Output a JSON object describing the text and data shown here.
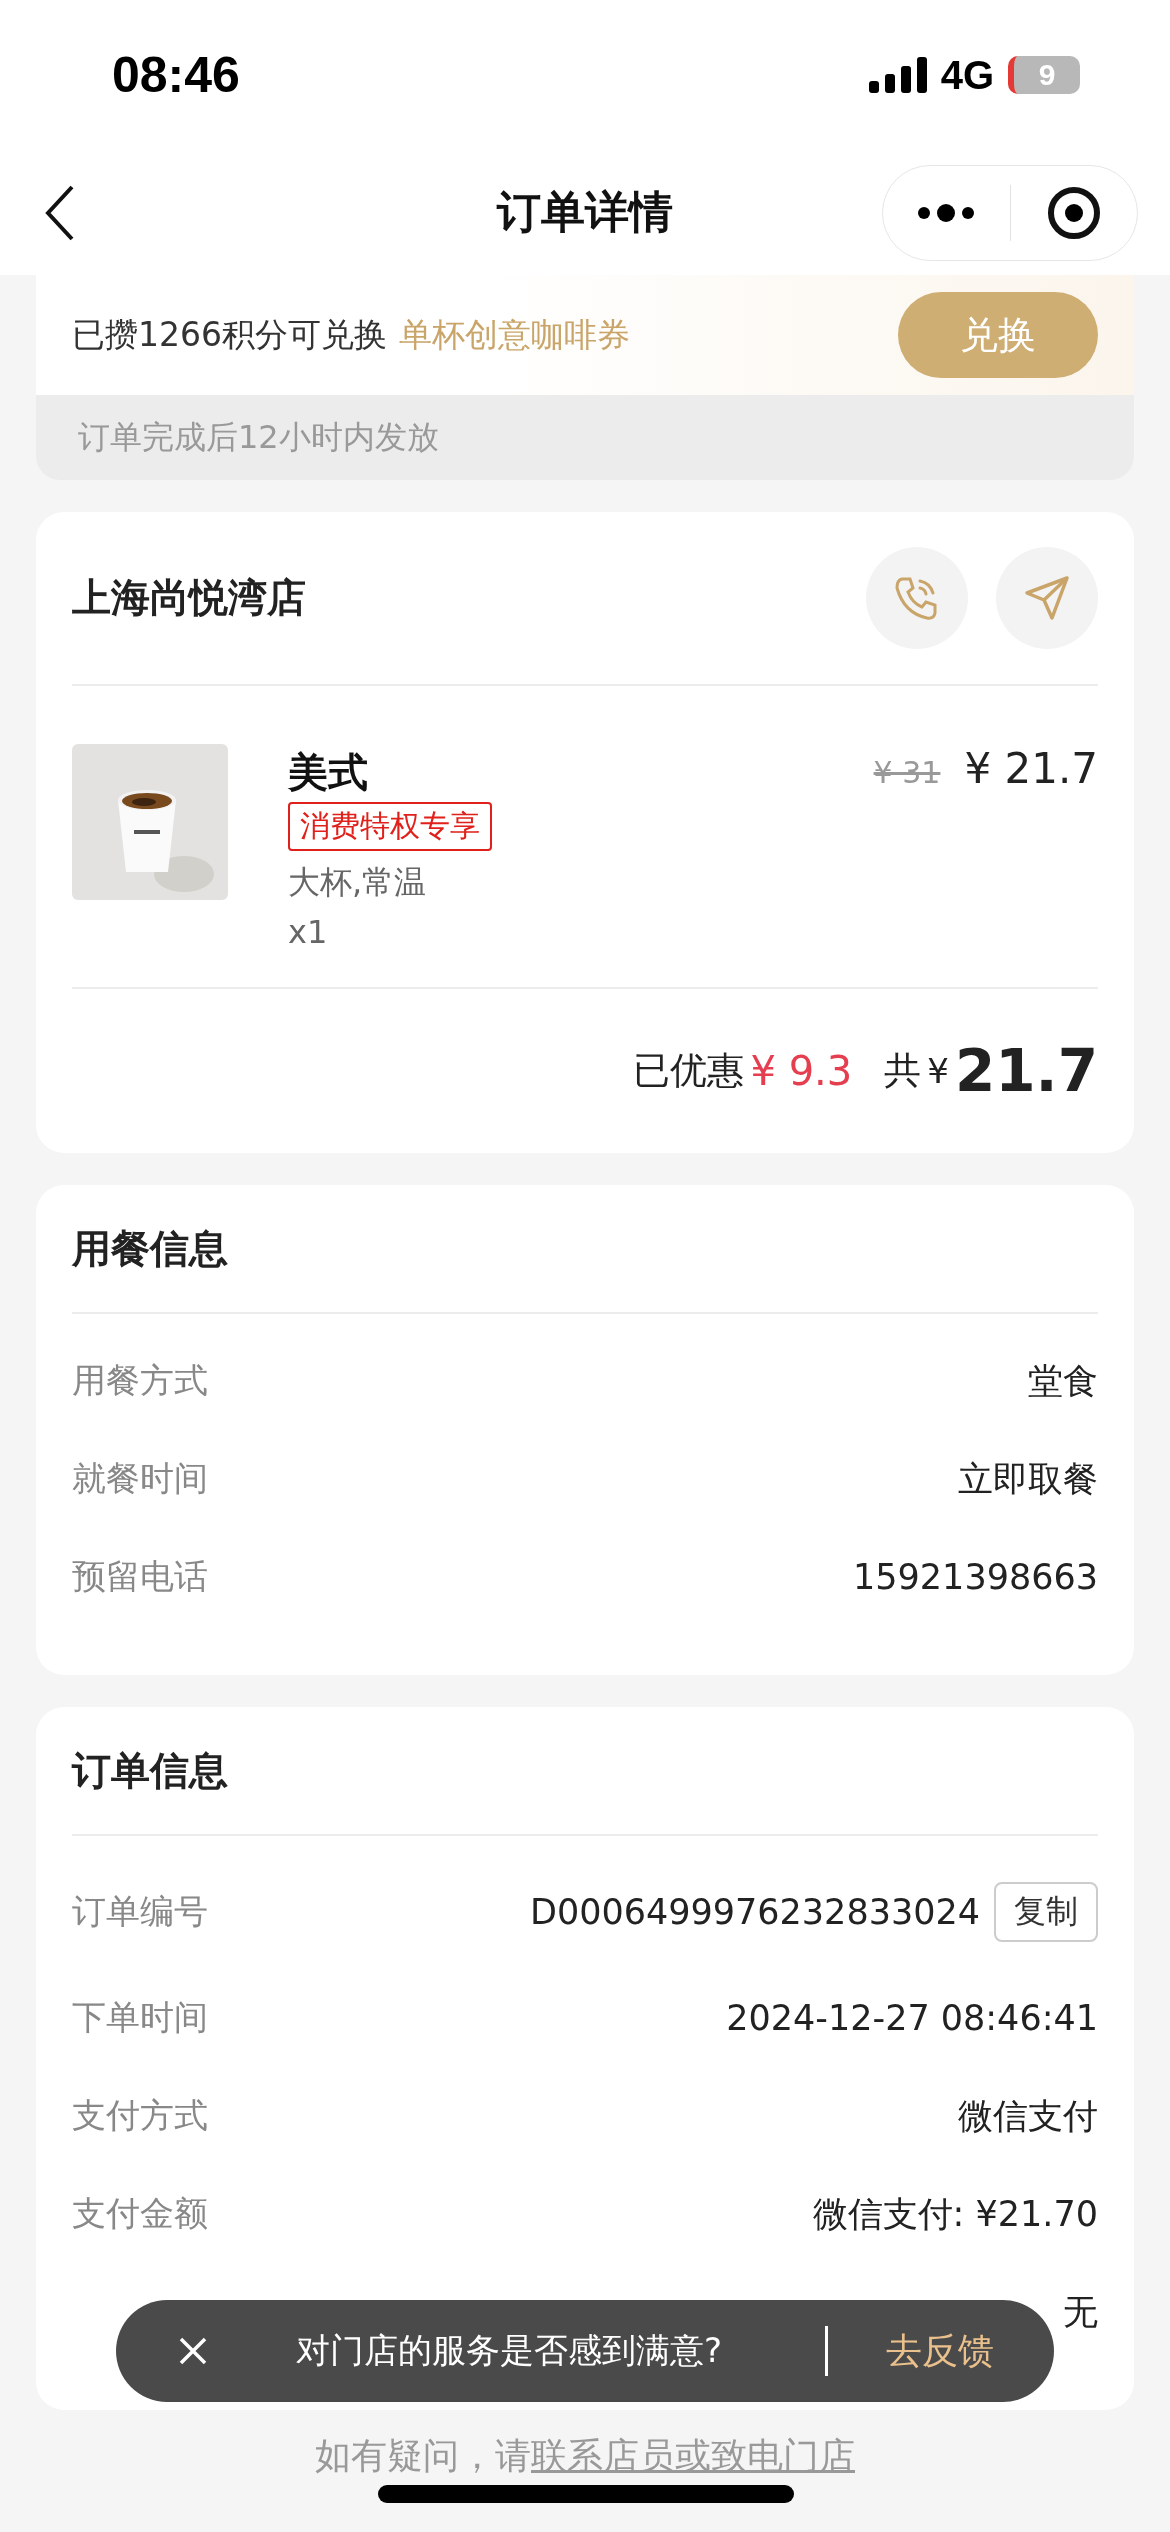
{
  "status_bar": {
    "time": "08:46",
    "network": "4G",
    "battery": "9"
  },
  "nav": {
    "title": "订单详情"
  },
  "points_banner": {
    "text": "已攒1266积分可兑换",
    "coupon": "单杯创意咖啡券",
    "button": "兑换",
    "note": "订单完成后12小时内发放"
  },
  "store": {
    "name": "上海尚悦湾店",
    "items": [
      {
        "name": "美式",
        "tag": "消费特权专享",
        "specs": "大杯,常温",
        "quantity": "x1",
        "original_price": "¥ 31",
        "price": "¥ 21.7"
      }
    ],
    "discount_label": "已优惠",
    "discount_amount": "¥ 9.3",
    "total_label": "共",
    "total_currency": "¥",
    "total_amount": "21.7"
  },
  "dining_info": {
    "title": "用餐信息",
    "rows": [
      {
        "label": "用餐方式",
        "value": "堂食"
      },
      {
        "label": "就餐时间",
        "value": "立即取餐"
      },
      {
        "label": "预留电话",
        "value": "15921398663"
      }
    ]
  },
  "order_info": {
    "title": "订单信息",
    "rows": [
      {
        "label": "订单编号",
        "value": "D0006499976232833024",
        "action": "复制"
      },
      {
        "label": "下单时间",
        "value": "2024-12-27 08:46:41"
      },
      {
        "label": "支付方式",
        "value": "微信支付"
      },
      {
        "label": "支付金额",
        "value": "微信支付: ¥21.70"
      },
      {
        "value": "无"
      }
    ]
  },
  "toast": {
    "text": "对门店的服务是否感到满意?",
    "action": "去反馈"
  },
  "footer": {
    "text": "如有疑问，请",
    "link": "联系店员或致电门店"
  }
}
